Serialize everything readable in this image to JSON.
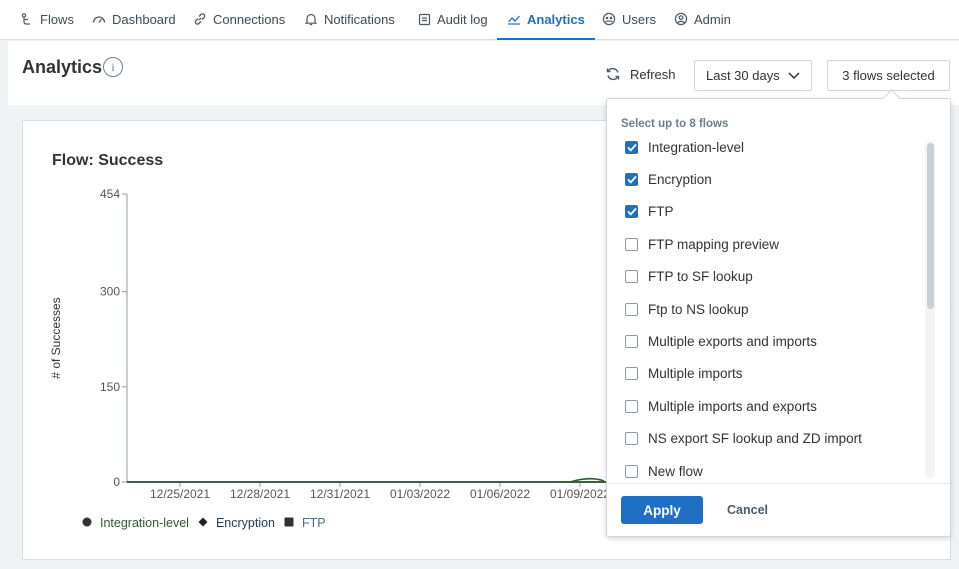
{
  "nav": {
    "items": [
      {
        "label": "Flows",
        "icon": "flows-icon",
        "active": false
      },
      {
        "label": "Dashboard",
        "icon": "dashboard-icon",
        "active": false
      },
      {
        "label": "Connections",
        "icon": "link-icon",
        "active": false
      },
      {
        "label": "Notifications",
        "icon": "bell-icon",
        "active": false
      },
      {
        "label": "Audit log",
        "icon": "audit-icon",
        "active": false
      },
      {
        "label": "Analytics",
        "icon": "line-chart-icon",
        "active": true
      },
      {
        "label": "Users",
        "icon": "users-icon",
        "active": false
      },
      {
        "label": "Admin",
        "icon": "admin-icon",
        "active": false
      }
    ]
  },
  "page": {
    "title": "Analytics",
    "info_glyph": "i"
  },
  "toolbar": {
    "refresh_label": "Refresh",
    "range_label": "Last 30 days",
    "flows_label": "3 flows selected"
  },
  "chart_data": {
    "type": "line",
    "title": "Flow: Success",
    "ylabel": "# of Successes",
    "xlabel": "",
    "ylim": [
      0,
      454
    ],
    "yticks": [
      "454",
      "300",
      "150",
      "0"
    ],
    "x": [
      "12/25/2021",
      "12/28/2021",
      "12/31/2021",
      "01/03/2022",
      "01/06/2022",
      "01/09/2022"
    ],
    "series": [
      {
        "name": "Integration-level",
        "color": "#2d5a2d",
        "marker": "circle",
        "values": [
          0,
          0,
          0,
          0,
          0,
          0
        ]
      },
      {
        "name": "Encryption",
        "color": "#1e3a5f",
        "marker": "diamond",
        "values": [
          0,
          0,
          0,
          0,
          0,
          0
        ]
      },
      {
        "name": "FTP",
        "color": "#4a6e8a",
        "marker": "square",
        "values": [
          0,
          0,
          0,
          0,
          0,
          0
        ]
      }
    ]
  },
  "flow_selector": {
    "heading": "Select up to 8 flows",
    "options": [
      {
        "label": "Integration-level",
        "checked": true
      },
      {
        "label": "Encryption",
        "checked": true
      },
      {
        "label": "FTP",
        "checked": true
      },
      {
        "label": "FTP mapping preview",
        "checked": false
      },
      {
        "label": "FTP to SF lookup",
        "checked": false
      },
      {
        "label": "Ftp to NS lookup",
        "checked": false
      },
      {
        "label": "Multiple exports and imports",
        "checked": false
      },
      {
        "label": "Multiple imports",
        "checked": false
      },
      {
        "label": "Multiple imports and exports",
        "checked": false
      },
      {
        "label": "NS export SF lookup and ZD import",
        "checked": false
      },
      {
        "label": "New flow",
        "checked": false
      }
    ],
    "apply_label": "Apply",
    "cancel_label": "Cancel"
  },
  "colors": {
    "accent": "#1f6fc5",
    "nav_text": "#3d4a55",
    "border": "#d6dde3"
  }
}
